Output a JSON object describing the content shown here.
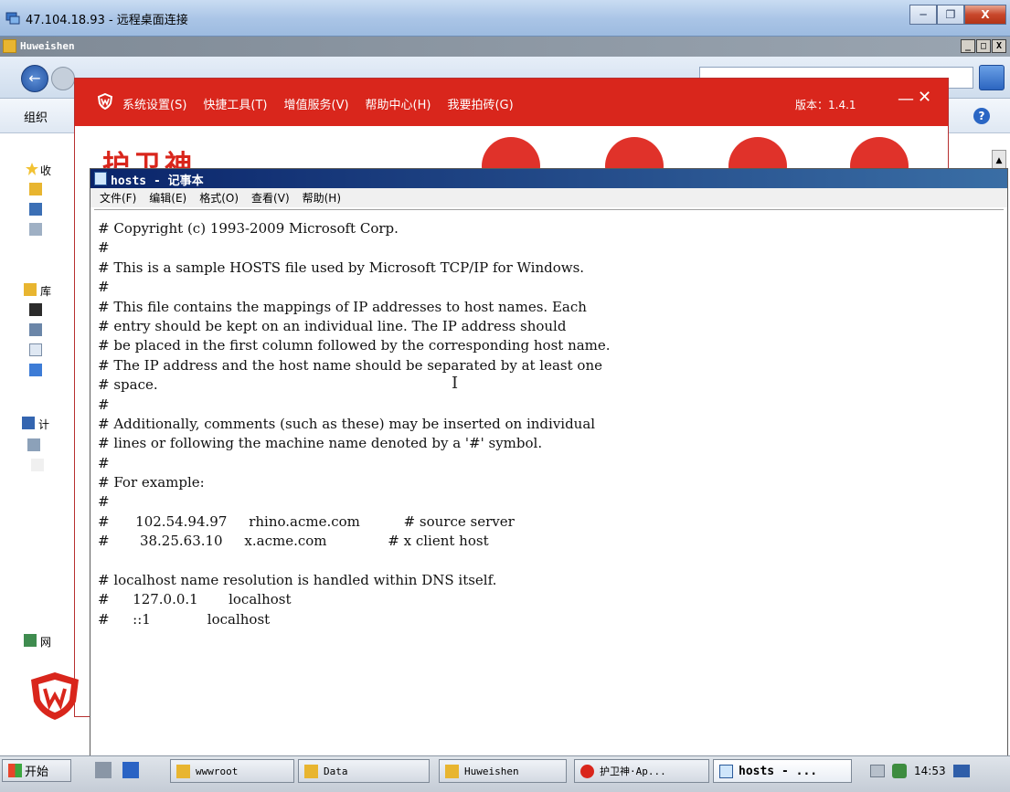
{
  "rdp": {
    "title": "47.104.18.93 - 远程桌面连接",
    "minimize_glyph": "─",
    "restore_glyph": "❐",
    "close_glyph": "X"
  },
  "explorer": {
    "title": "Huweishen",
    "controls": {
      "minimize": "_",
      "maximize": "□",
      "close": "X"
    },
    "toolbar_organize": "组织",
    "help_icon_glyph": "?",
    "sidebar_fragments": [
      "收",
      "库",
      "计",
      "网"
    ],
    "back_glyph": "←"
  },
  "huweishen_app": {
    "menu": [
      "系统设置(S)",
      "快捷工具(T)",
      "增值服务(V)",
      "帮助中心(H)",
      "我要拍砖(G)"
    ],
    "version": "版本：1.4.1",
    "minimize_glyph": "—",
    "close_glyph": "✕",
    "brand_text": "护卫神",
    "brand_color": "#d9261c"
  },
  "notepad": {
    "title": "hosts - 记事本",
    "menu": [
      "文件(F)",
      "编辑(E)",
      "格式(O)",
      "查看(V)",
      "帮助(H)"
    ],
    "lines": [
      "# Copyright (c) 1993-2009 Microsoft Corp.",
      "#",
      "# This is a sample HOSTS file used by Microsoft TCP/IP for Windows.",
      "#",
      "# This file contains the mappings of IP addresses to host names. Each",
      "# entry should be kept on an individual line. The IP address should",
      "# be placed in the first column followed by the corresponding host name.",
      "# The IP address and the host name should be separated by at least one",
      "# space.",
      "#",
      "# Additionally, comments (such as these) may be inserted on individual",
      "# lines or following the machine name denoted by a '#' symbol.",
      "#",
      "# For example:",
      "#",
      "#      102.54.94.97     rhino.acme.com          # source server",
      "#       38.25.63.10     x.acme.com              # x client host",
      "",
      "# localhost name resolution is handled within DNS itself.",
      "#\t127.0.0.1       localhost",
      "#\t::1             localhost"
    ],
    "cursor_glyph": "I"
  },
  "taskbar": {
    "start_label": "开始",
    "buttons": [
      {
        "label": "wwwroot",
        "icon": "folder-icon"
      },
      {
        "label": "Data",
        "icon": "folder-icon"
      },
      {
        "label": "Huweishen",
        "icon": "folder-icon"
      },
      {
        "label": "护卫神·Ap...",
        "icon": "huweishen-icon"
      },
      {
        "label": "hosts - ...",
        "icon": "notepad-icon"
      }
    ],
    "clock": "14:53"
  }
}
